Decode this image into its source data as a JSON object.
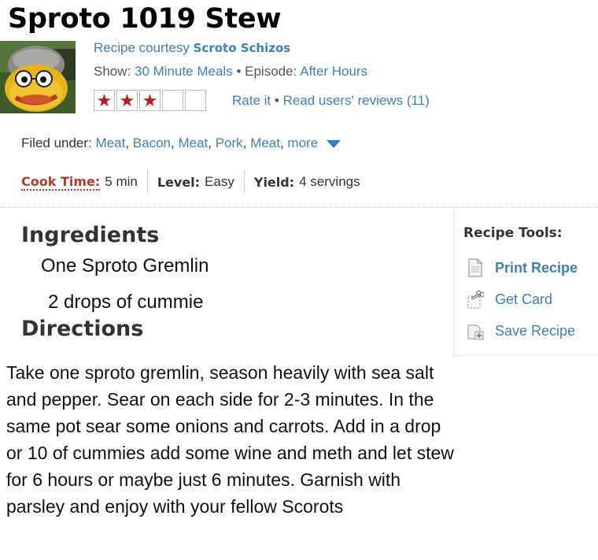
{
  "page": {
    "title": "Sproto 1019 Stew"
  },
  "meta": {
    "courtesy_label": "Recipe courtesy",
    "author": "Scroto Schizos",
    "show_label": "Show:",
    "show_name": "30 Minute Meals",
    "episode_sep": "•",
    "episode_label": "Episode:",
    "episode_name": "After Hours",
    "rating_stars": 3,
    "rating_max": 5,
    "rate_it": "Rate it",
    "reviews_sep": "•",
    "reviews_link": "Read users' reviews (11)"
  },
  "filed": {
    "label": "Filed under:",
    "tags": [
      "Meat",
      "Bacon",
      "Meat",
      "Pork",
      "Meat"
    ],
    "more": "more"
  },
  "infobar": {
    "cook_time_label": "Cook Time:",
    "cook_time_value": "5 min",
    "level_label": "Level:",
    "level_value": "Easy",
    "yield_label": "Yield:",
    "yield_value": "4 servings"
  },
  "ingredients": {
    "heading": "Ingredients",
    "items": [
      "One Sproto Gremlin",
      "2 drops of cummie"
    ]
  },
  "directions": {
    "heading": "Directions",
    "text": "Take one sproto gremlin, season heavily with sea salt and pepper. Sear on each side for 2-3 minutes. In the same pot sear some onions and carrots. Add in a drop or 10 of cummies add some wine and meth and let stew for 6 hours or maybe just 6 minutes. Garnish with parsley and enjoy with your fellow Scorots"
  },
  "tools": {
    "title": "Recipe Tools:",
    "print": "Print Recipe",
    "card": "Get Card",
    "save": "Save Recipe",
    "print_icon": "document-icon",
    "card_icon": "scissors-card-icon",
    "save_icon": "save-plus-icon"
  },
  "colors": {
    "link": "#3f7fb8",
    "cook_time": "#b53a2e",
    "star": "#b71c1c",
    "more_arrow": "#2f7fc8"
  }
}
